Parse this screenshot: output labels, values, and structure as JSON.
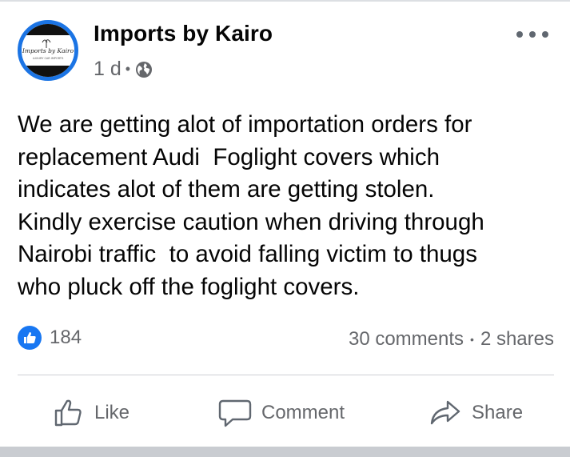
{
  "post": {
    "author": "Imports by Kairo",
    "avatar_text_main": "Imports by Kairo",
    "avatar_text_sub": "LUXURY CAR IMPORTS",
    "time": "1 d",
    "time_separator": "•",
    "privacy_icon": "globe-icon",
    "text": "We are getting alot of importation orders for\nreplacement Audi  Foglight covers which\nindicates alot of them are getting stolen.\nKindly exercise caution when driving through\nNairobi traffic  to avoid falling victim to thugs\nwho pluck off the foglight covers."
  },
  "reactions": {
    "count": "184",
    "icon": "like-reaction-icon"
  },
  "stats": {
    "comments": "30 comments",
    "separator": "•",
    "shares": "2 shares"
  },
  "actions": {
    "like": "Like",
    "comment": "Comment",
    "share": "Share"
  },
  "colors": {
    "accent": "#1877f2",
    "avatar_ring": "#1b74e4",
    "secondary_text": "#65676b"
  }
}
